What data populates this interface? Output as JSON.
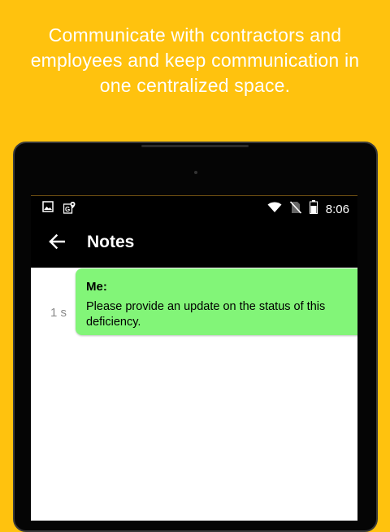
{
  "promo": {
    "line1": "Communicate with contractors and",
    "line2": "employees and keep communication in",
    "line3": "one centralized space."
  },
  "status_bar": {
    "time": "8:06",
    "left_icons": [
      "image-icon",
      "maps-notification-icon"
    ],
    "right_icons": [
      "wifi-icon",
      "no-sim-icon",
      "battery-icon"
    ]
  },
  "app_bar": {
    "back_icon": "arrow-left-icon",
    "title": "Notes"
  },
  "messages": [
    {
      "time": "1 s",
      "sender": "Me:",
      "text": "Please provide an update on the status of this deficiency."
    }
  ],
  "colors": {
    "background": "#FFC20E",
    "bubble": "#82F578",
    "app_bar": "#000000"
  }
}
